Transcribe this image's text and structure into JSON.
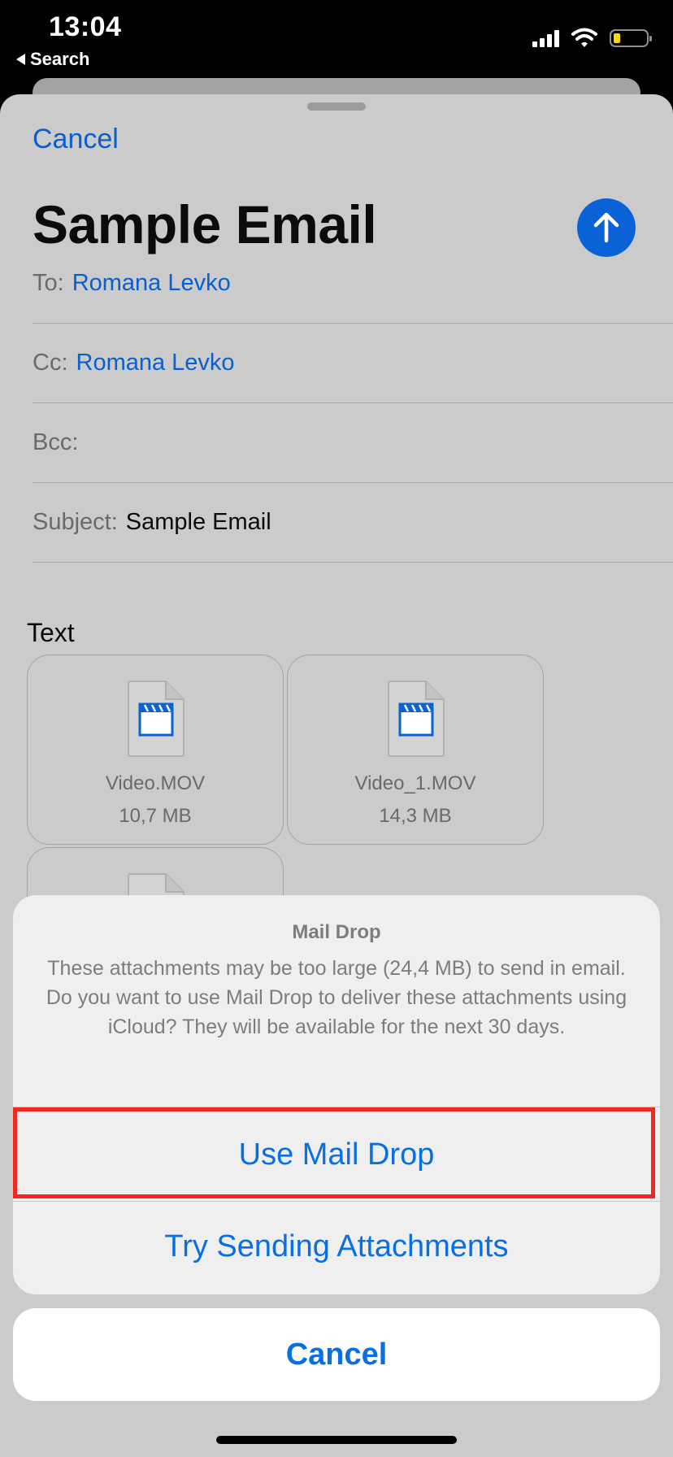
{
  "status_bar": {
    "time": "13:04",
    "back_label": "Search"
  },
  "compose": {
    "cancel_label": "Cancel",
    "title": "Sample Email",
    "to_label": "To:",
    "to_value": "Romana Levko",
    "cc_label": "Cc:",
    "cc_value": "Romana Levko",
    "bcc_label": "Bcc:",
    "subject_label": "Subject:",
    "subject_value": "Sample Email",
    "body": "Text",
    "attachments": [
      {
        "name": "Video.MOV",
        "size": "10,7 MB"
      },
      {
        "name": "Video_1.MOV",
        "size": "14,3 MB"
      }
    ]
  },
  "action_sheet": {
    "title": "Mail Drop",
    "message": "These attachments may be too large (24,4 MB) to send in email. Do you want to use Mail Drop to deliver these attachments using iCloud? They will be available for the next 30 days.",
    "use_mail_drop": "Use Mail Drop",
    "try_sending": "Try Sending Attachments",
    "cancel": "Cancel"
  },
  "colors": {
    "accent": "#0A6FE0",
    "highlight": "#F0281E"
  }
}
